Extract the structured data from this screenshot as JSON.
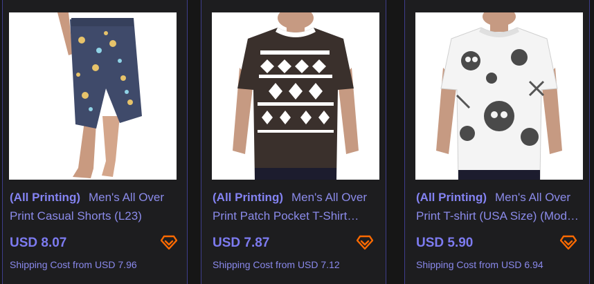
{
  "products": [
    {
      "tag": "(All Printing)",
      "name": "Men's All Over Print Casual Shorts (L23)",
      "price": "USD 8.07",
      "shipping": "Shipping Cost from USD 7.96",
      "badge_icon": "diamond-icon"
    },
    {
      "tag": "(All Printing)",
      "name": "Men's All Over Print Patch Pocket T-Shirt…",
      "price": "USD 7.87",
      "shipping": "Shipping Cost from USD 7.12",
      "badge_icon": "diamond-icon"
    },
    {
      "tag": "(All Printing)",
      "name": "Men's All Over Print T-shirt (USA Size) (Mod…",
      "price": "USD 5.90",
      "shipping": "Shipping Cost from USD 6.94",
      "badge_icon": "diamond-icon"
    }
  ],
  "colors": {
    "background": "#161616",
    "card": "#1d1d1f",
    "accent": "#8483f2",
    "badge": "#ff6a00"
  }
}
